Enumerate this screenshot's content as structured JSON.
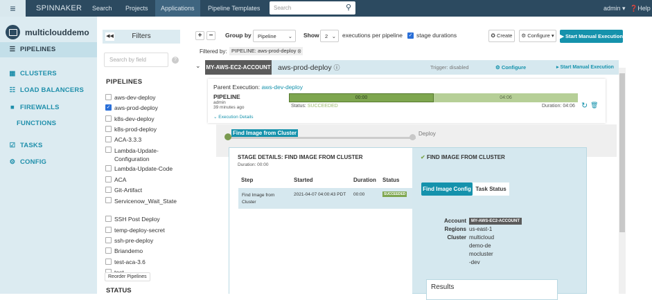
{
  "nav": {
    "brand": "SPINNAKER",
    "items": [
      "Search",
      "Projects",
      "Applications",
      "Pipeline Templates"
    ],
    "search_placeholder": "Search",
    "user": "admin",
    "help": "Help"
  },
  "sidebar": {
    "app_name": "multiclouddemo",
    "items": [
      {
        "label": "PIPELINES",
        "icon": "list-icon"
      },
      {
        "label": "CLUSTERS",
        "icon": "grid-icon"
      },
      {
        "label": "LOAD BALANCERS",
        "icon": "sitemap-icon"
      },
      {
        "label": "FIREWALLS",
        "icon": "lock-icon"
      },
      {
        "label": "FUNCTIONS",
        "icon": ""
      },
      {
        "label": "TASKS",
        "icon": "check-square-icon"
      },
      {
        "label": "CONFIG",
        "icon": "gear-icon"
      }
    ]
  },
  "filters": {
    "title": "Filters",
    "search_placeholder": "Search by field",
    "pipelines_heading": "PIPELINES",
    "pipelines": [
      {
        "label": "aws-dev-deploy",
        "checked": false
      },
      {
        "label": "aws-prod-deploy",
        "checked": true
      },
      {
        "label": "k8s-dev-deploy",
        "checked": false
      },
      {
        "label": "k8s-prod-deploy",
        "checked": false
      },
      {
        "label": "ACA-3.3.3",
        "checked": false
      },
      {
        "label": "Lambda-Update-Configuration",
        "checked": false
      },
      {
        "label": "Lambda-Update-Code",
        "checked": false
      },
      {
        "label": "ACA",
        "checked": false
      },
      {
        "label": "Git-Artifact",
        "checked": false
      },
      {
        "label": "Servicenow_Wait_State",
        "checked": false
      },
      {
        "label": "SSH Post Deploy",
        "checked": false
      },
      {
        "label": "temp-deploy-secret",
        "checked": false
      },
      {
        "label": "ssh-pre-deploy",
        "checked": false
      },
      {
        "label": "Briandemo",
        "checked": false
      },
      {
        "label": "test-aca-3.6",
        "checked": false
      },
      {
        "label": "test",
        "checked": false
      }
    ],
    "reorder_label": "Reorder Pipelines",
    "status_heading": "STATUS"
  },
  "toolbar": {
    "group_by_label": "Group by",
    "group_by_value": "Pipeline",
    "show_label": "Show",
    "show_value": "2",
    "per_pipeline_label": "executions per pipeline",
    "stage_durations_label": "stage durations",
    "stage_durations_checked": true,
    "create_label": "Create",
    "configure_label": "Configure",
    "start_label": "Start Manual Execution",
    "filtered_by_label": "Filtered by:",
    "filter_tag": "PIPELINE: aws-prod-deploy"
  },
  "pipeline": {
    "account": "MY-AWS-EC2-ACCOUNT",
    "name": "aws-prod-deploy",
    "trigger": "Trigger: disabled",
    "configure_label": "Configure",
    "start_label": "Start Manual Execution",
    "execution": {
      "parent_label": "Parent Execution:",
      "parent_link": "aws-dev-deploy",
      "type": "PIPELINE",
      "user": "admin",
      "time_ago": "39 minutes ago",
      "details_label": "Execution Details",
      "bar_stage1": "00:00",
      "bar_stage2": "04:06",
      "status_label": "Status:",
      "status": "SUCCEEDED",
      "duration_label": "Duration:",
      "duration": "04:06"
    },
    "stages": [
      "Find Image from Cluster",
      "Deploy"
    ]
  },
  "stage_details": {
    "title": "STAGE DETAILS: FIND IMAGE FROM CLUSTER",
    "duration": "Duration: 00:00",
    "columns": [
      "Step",
      "Started",
      "Duration",
      "Status"
    ],
    "row": {
      "step": "Find Image from Cluster",
      "started": "2021-04-07 04:00:43 PDT",
      "duration": "00:00",
      "status": "SUCCEEDED"
    },
    "right_title": "FIND IMAGE FROM CLUSTER",
    "tabs": [
      "Find Image Config",
      "Task Status"
    ],
    "config": {
      "account_label": "Account",
      "account": "MY-AWS-EC2-ACCOUNT",
      "regions_label": "Regions",
      "regions": "us-east-1",
      "cluster_label": "Cluster",
      "cluster": "multiclouddemo-democluster-dev"
    },
    "results_label": "Results"
  },
  "colors": {
    "nav": "#2c4a60",
    "accent": "#1592ac",
    "success": "#7ea64f"
  }
}
